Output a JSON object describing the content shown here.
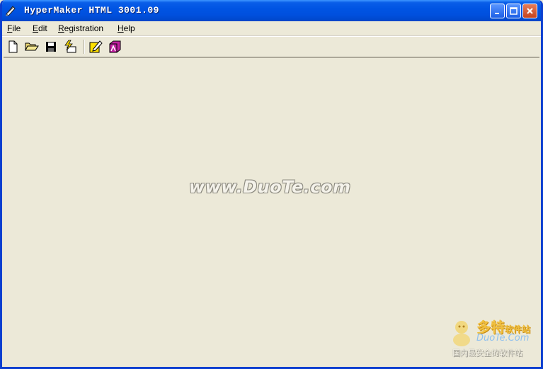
{
  "window": {
    "title": "HyperMaker HTML 3001.09"
  },
  "title_buttons": {
    "minimize": "minimize-icon",
    "maximize": "maximize-icon",
    "close": "close-icon"
  },
  "menu": [
    {
      "label": "File",
      "mnemonic": "F",
      "rest": "ile"
    },
    {
      "label": "Edit",
      "mnemonic": "E",
      "rest": "dit"
    },
    {
      "label": "Registration",
      "mnemonic": "R",
      "rest": "egistration"
    },
    {
      "label": "Help",
      "mnemonic": "H",
      "rest": "elp"
    }
  ],
  "toolbar": [
    "new-file-icon",
    "open-folder-icon",
    "save-disk-icon",
    "build-flash-icon",
    "edit-pencil-icon",
    "publish-icon"
  ],
  "watermark": {
    "text": "www.DuoTe.com"
  },
  "logo": {
    "title_main": "多特",
    "title_small": "软件站",
    "domain": "DuoTe.Com",
    "slogan": "国内最安全的软件站"
  },
  "colors": {
    "titlebar": "#0054e3",
    "face": "#ece9d8",
    "close": "#c7431d"
  }
}
